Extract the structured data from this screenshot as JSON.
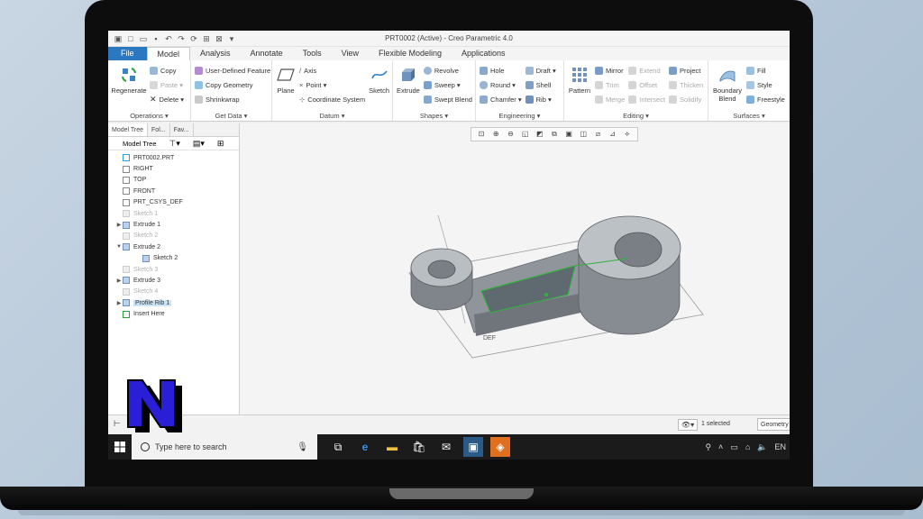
{
  "window": {
    "title": "PRT0002 (Active) - Creo Parametric 4.0"
  },
  "ribbon_tabs": [
    {
      "label": "File"
    },
    {
      "label": "Model"
    },
    {
      "label": "Analysis"
    },
    {
      "label": "Annotate"
    },
    {
      "label": "Tools"
    },
    {
      "label": "View"
    },
    {
      "label": "Flexible Modeling"
    },
    {
      "label": "Applications"
    }
  ],
  "ribbon": {
    "operations": {
      "label": "Operations ▾",
      "regenerate": "Regenerate",
      "copy": "Copy",
      "paste": "Paste ▾",
      "delete": "Delete ▾"
    },
    "get_data": {
      "label": "Get Data ▾",
      "udf": "User-Defined Feature",
      "copy_geometry": "Copy Geometry",
      "shrinkwrap": "Shrinkwrap"
    },
    "datum": {
      "label": "Datum ▾",
      "plane": "Plane",
      "axis": "Axis",
      "point": "Point ▾",
      "csys": "Coordinate System",
      "sketch": "Sketch"
    },
    "shapes": {
      "label": "Shapes ▾",
      "extrude": "Extrude",
      "revolve": "Revolve",
      "sweep": "Sweep ▾",
      "swept_blend": "Swept Blend"
    },
    "engineering": {
      "label": "Engineering ▾",
      "hole": "Hole",
      "round": "Round ▾",
      "chamfer": "Chamfer ▾",
      "draft": "Draft ▾",
      "shell": "Shell",
      "rib": "Rib ▾"
    },
    "editing": {
      "label": "Editing ▾",
      "pattern": "Pattern",
      "mirror": "Mirror",
      "trim": "Trim",
      "merge": "Merge",
      "extend": "Extend",
      "offset": "Offset",
      "intersect": "Intersect",
      "project": "Project",
      "thicken": "Thicken",
      "solidify": "Solidify"
    },
    "surfaces": {
      "label": "Surfaces ▾",
      "boundary_blend": "Boundary Blend",
      "fill": "Fill",
      "style": "Style",
      "freestyle": "Freestyle"
    }
  },
  "left_panel": {
    "tabs": [
      "Model Tree",
      "Fol...",
      "Fav..."
    ],
    "header": "Model Tree",
    "tree": [
      {
        "label": "PRT0002.PRT",
        "dim": false,
        "expand": ""
      },
      {
        "label": "RIGHT",
        "dim": false,
        "expand": ""
      },
      {
        "label": "TOP",
        "dim": false,
        "expand": ""
      },
      {
        "label": "FRONT",
        "dim": false,
        "expand": ""
      },
      {
        "label": "PRT_CSYS_DEF",
        "dim": false,
        "expand": ""
      },
      {
        "label": "Sketch 1",
        "dim": true,
        "expand": ""
      },
      {
        "label": "Extrude 1",
        "dim": false,
        "expand": "▶"
      },
      {
        "label": "Sketch 2",
        "dim": true,
        "expand": ""
      },
      {
        "label": "Extrude 2",
        "dim": false,
        "expand": "▼"
      },
      {
        "label": "Sketch 2",
        "dim": false,
        "expand": ""
      },
      {
        "label": "Sketch 3",
        "dim": true,
        "expand": ""
      },
      {
        "label": "Extrude 3",
        "dim": false,
        "expand": "▶"
      },
      {
        "label": "Sketch 4",
        "dim": true,
        "expand": ""
      },
      {
        "label": "Profile Rib 1",
        "dim": false,
        "expand": "▶",
        "selected": true
      },
      {
        "label": "Insert Here",
        "dim": false,
        "expand": ""
      }
    ]
  },
  "viewport": {
    "csys_label": "DEF"
  },
  "status": {
    "selected": "1 selected",
    "filter": "Geometry"
  },
  "taskbar": {
    "search_placeholder": "Type here to search",
    "lang": "EN"
  },
  "colors": {
    "file_tab": "#2b78c0",
    "logo_fill": "#2a1fd6"
  }
}
